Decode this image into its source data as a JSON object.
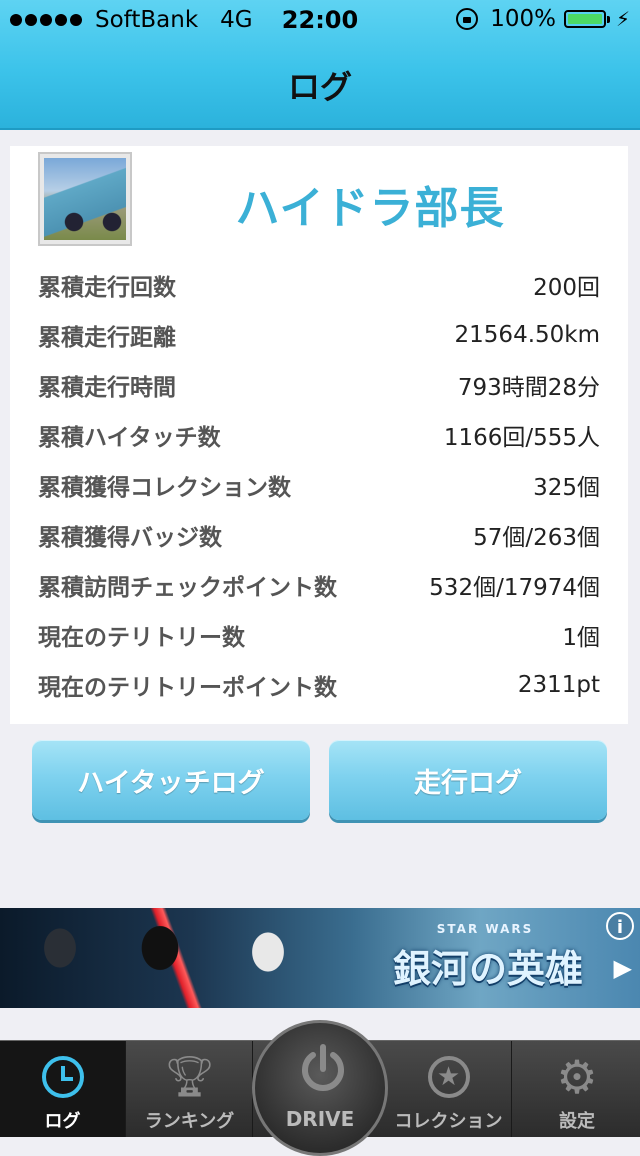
{
  "status_bar": {
    "carrier": "SoftBank",
    "network": "4G",
    "time": "22:00",
    "battery": "100%"
  },
  "nav": {
    "title": "ログ"
  },
  "profile": {
    "name": "ハイドラ部長",
    "stats": [
      {
        "label": "累積走行回数",
        "value": "200回"
      },
      {
        "label": "累積走行距離",
        "value": "21564.50km"
      },
      {
        "label": "累積走行時間",
        "value": "793時間28分"
      },
      {
        "label": "累積ハイタッチ数",
        "value": "1166回/555人"
      },
      {
        "label": "累積獲得コレクション数",
        "value": "325個"
      },
      {
        "label": "累積獲得バッジ数",
        "value": "57個/263個"
      },
      {
        "label": "累積訪問チェックポイント数",
        "value": "532個/17974個"
      },
      {
        "label": "現在のテリトリー数",
        "value": "1個"
      },
      {
        "label": "現在のテリトリーポイント数",
        "value": "2311pt"
      }
    ]
  },
  "buttons": {
    "hightouch_log": "ハイタッチログ",
    "drive_log": "走行ログ"
  },
  "ad": {
    "logo_top": "STAR WARS",
    "logo": "銀河の英雄",
    "info": "i"
  },
  "tabbar": {
    "log": "ログ",
    "ranking": "ランキング",
    "drive": "DRIVE",
    "collection": "コレクション",
    "settings": "設定"
  },
  "colors": {
    "header": "#3cc3ea",
    "accent": "#3bb0d6",
    "button": "#7fd2ef",
    "tabbar": "#2c2c2c"
  }
}
